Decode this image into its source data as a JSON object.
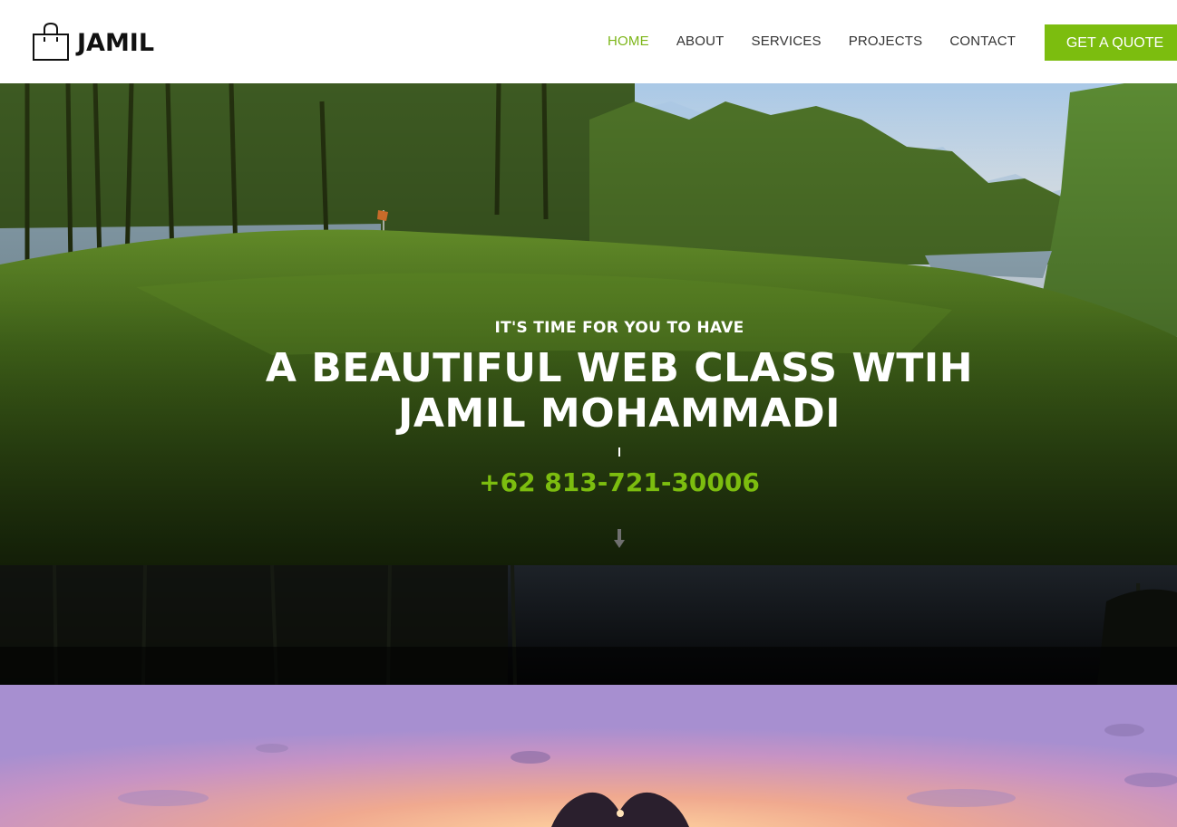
{
  "brand": {
    "name": "JAMIL",
    "icon": "shopping-bag-icon"
  },
  "nav": {
    "items": [
      {
        "label": "HOME",
        "active": true
      },
      {
        "label": "ABOUT",
        "active": false
      },
      {
        "label": "SERVICES",
        "active": false
      },
      {
        "label": "PROJECTS",
        "active": false
      },
      {
        "label": "CONTACT",
        "active": false
      }
    ],
    "cta_label": "GET A QUOTE"
  },
  "hero": {
    "kicker": "IT'S TIME FOR YOU TO HAVE",
    "title_line_1": "A BEAUTIFUL WEB CLASS WTIH",
    "title_line_2": "JAMIL MOHAMMADI",
    "phone": "+62 813-721-30006",
    "scroll_icon": "arrow-down-icon"
  },
  "colors": {
    "accent": "#7cbd0f",
    "nav_text": "#333333",
    "brand_text": "#111111",
    "hero_text": "#ffffff"
  }
}
